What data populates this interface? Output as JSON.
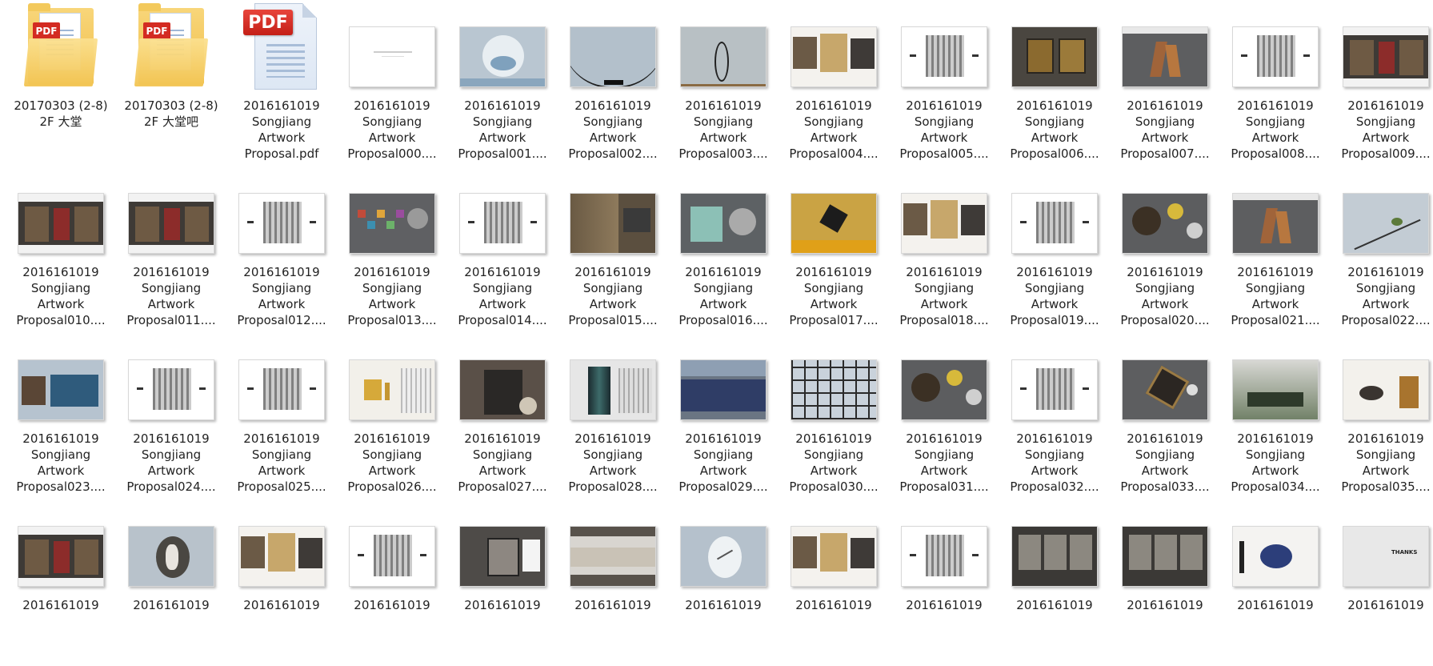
{
  "items": [
    {
      "kind": "folder",
      "label": "20170303 (2-8)\n2F 大堂",
      "badge": "PDF"
    },
    {
      "kind": "folder",
      "label": "20170303 (2-8)\n2F 大堂吧",
      "badge": "PDF"
    },
    {
      "kind": "pdf",
      "label": "2016161019\nSongjiang\nArtwork\nProposal.pdf",
      "badge": "PDF"
    },
    {
      "kind": "thumb",
      "style": "white",
      "label": "2016161019\nSongjiang\nArtwork\nProposal000...."
    },
    {
      "kind": "thumb",
      "style": "cloud",
      "label": "2016161019\nSongjiang\nArtwork\nProposal001...."
    },
    {
      "kind": "thumb",
      "style": "curve",
      "label": "2016161019\nSongjiang\nArtwork\nProposal002...."
    },
    {
      "kind": "thumb",
      "style": "ring",
      "label": "2016161019\nSongjiang\nArtwork\nProposal003...."
    },
    {
      "kind": "thumb",
      "style": "collage",
      "label": "2016161019\nSongjiang\nArtwork\nProposal004...."
    },
    {
      "kind": "thumb",
      "style": "plan",
      "label": "2016161019\nSongjiang\nArtwork\nProposal005...."
    },
    {
      "kind": "thumb",
      "style": "darkgold",
      "label": "2016161019\nSongjiang\nArtwork\nProposal006...."
    },
    {
      "kind": "thumb",
      "style": "sculpt",
      "label": "2016161019\nSongjiang\nArtwork\nProposal007...."
    },
    {
      "kind": "thumb",
      "style": "plan",
      "label": "2016161019\nSongjiang\nArtwork\nProposal008...."
    },
    {
      "kind": "thumb",
      "style": "room",
      "label": "2016161019\nSongjiang\nArtwork\nProposal009...."
    },
    {
      "kind": "thumb",
      "style": "room",
      "label": "2016161019\nSongjiang\nArtwork\nProposal010...."
    },
    {
      "kind": "thumb",
      "style": "room",
      "label": "2016161019\nSongjiang\nArtwork\nProposal011...."
    },
    {
      "kind": "thumb",
      "style": "plan",
      "label": "2016161019\nSongjiang\nArtwork\nProposal012...."
    },
    {
      "kind": "thumb",
      "style": "colorful",
      "label": "2016161019\nSongjiang\nArtwork\nProposal013...."
    },
    {
      "kind": "thumb",
      "style": "plan",
      "label": "2016161019\nSongjiang\nArtwork\nProposal014...."
    },
    {
      "kind": "thumb",
      "style": "brown",
      "label": "2016161019\nSongjiang\nArtwork\nProposal015...."
    },
    {
      "kind": "thumb",
      "style": "teal",
      "label": "2016161019\nSongjiang\nArtwork\nProposal016...."
    },
    {
      "kind": "thumb",
      "style": "gold",
      "label": "2016161019\nSongjiang\nArtwork\nProposal017...."
    },
    {
      "kind": "thumb",
      "style": "collage",
      "label": "2016161019\nSongjiang\nArtwork\nProposal018...."
    },
    {
      "kind": "thumb",
      "style": "plan",
      "label": "2016161019\nSongjiang\nArtwork\nProposal019...."
    },
    {
      "kind": "thumb",
      "style": "circles",
      "label": "2016161019\nSongjiang\nArtwork\nProposal020...."
    },
    {
      "kind": "thumb",
      "style": "sculpt",
      "label": "2016161019\nSongjiang\nArtwork\nProposal021...."
    },
    {
      "kind": "thumb",
      "style": "branch",
      "label": "2016161019\nSongjiang\nArtwork\nProposal022...."
    },
    {
      "kind": "thumb",
      "style": "blue",
      "label": "2016161019\nSongjiang\nArtwork\nProposal023...."
    },
    {
      "kind": "thumb",
      "style": "plan",
      "label": "2016161019\nSongjiang\nArtwork\nProposal024...."
    },
    {
      "kind": "thumb",
      "style": "plan",
      "label": "2016161019\nSongjiang\nArtwork\nProposal025...."
    },
    {
      "kind": "thumb",
      "style": "goldbars",
      "label": "2016161019\nSongjiang\nArtwork\nProposal026...."
    },
    {
      "kind": "thumb",
      "style": "dark",
      "label": "2016161019\nSongjiang\nArtwork\nProposal027...."
    },
    {
      "kind": "thumb",
      "style": "column",
      "label": "2016161019\nSongjiang\nArtwork\nProposal028...."
    },
    {
      "kind": "thumb",
      "style": "navy",
      "label": "2016161019\nSongjiang\nArtwork\nProposal029...."
    },
    {
      "kind": "thumb",
      "style": "lattice",
      "label": "2016161019\nSongjiang\nArtwork\nProposal030...."
    },
    {
      "kind": "thumb",
      "style": "circles",
      "label": "2016161019\nSongjiang\nArtwork\nProposal031...."
    },
    {
      "kind": "thumb",
      "style": "plan",
      "label": "2016161019\nSongjiang\nArtwork\nProposal032...."
    },
    {
      "kind": "thumb",
      "style": "hex",
      "label": "2016161019\nSongjiang\nArtwork\nProposal033...."
    },
    {
      "kind": "thumb",
      "style": "green",
      "label": "2016161019\nSongjiang\nArtwork\nProposal034...."
    },
    {
      "kind": "thumb",
      "style": "table",
      "label": "2016161019\nSongjiang\nArtwork\nProposal035...."
    },
    {
      "kind": "thumb",
      "style": "room",
      "label": "2016161019"
    },
    {
      "kind": "thumb",
      "style": "disc",
      "label": "2016161019"
    },
    {
      "kind": "thumb",
      "style": "collage",
      "label": "2016161019"
    },
    {
      "kind": "thumb",
      "style": "plan",
      "label": "2016161019"
    },
    {
      "kind": "thumb",
      "style": "frame",
      "label": "2016161019"
    },
    {
      "kind": "thumb",
      "style": "band",
      "label": "2016161019"
    },
    {
      "kind": "thumb",
      "style": "disc2",
      "label": "2016161019"
    },
    {
      "kind": "thumb",
      "style": "collage",
      "label": "2016161019"
    },
    {
      "kind": "thumb",
      "style": "plan",
      "label": "2016161019"
    },
    {
      "kind": "thumb",
      "style": "vitrine",
      "label": "2016161019"
    },
    {
      "kind": "thumb",
      "style": "vitrine",
      "label": "2016161019"
    },
    {
      "kind": "thumb",
      "style": "bowl",
      "label": "2016161019"
    },
    {
      "kind": "thumb",
      "style": "thanks",
      "thanks_text": "THANKS",
      "label": "2016161019"
    }
  ]
}
